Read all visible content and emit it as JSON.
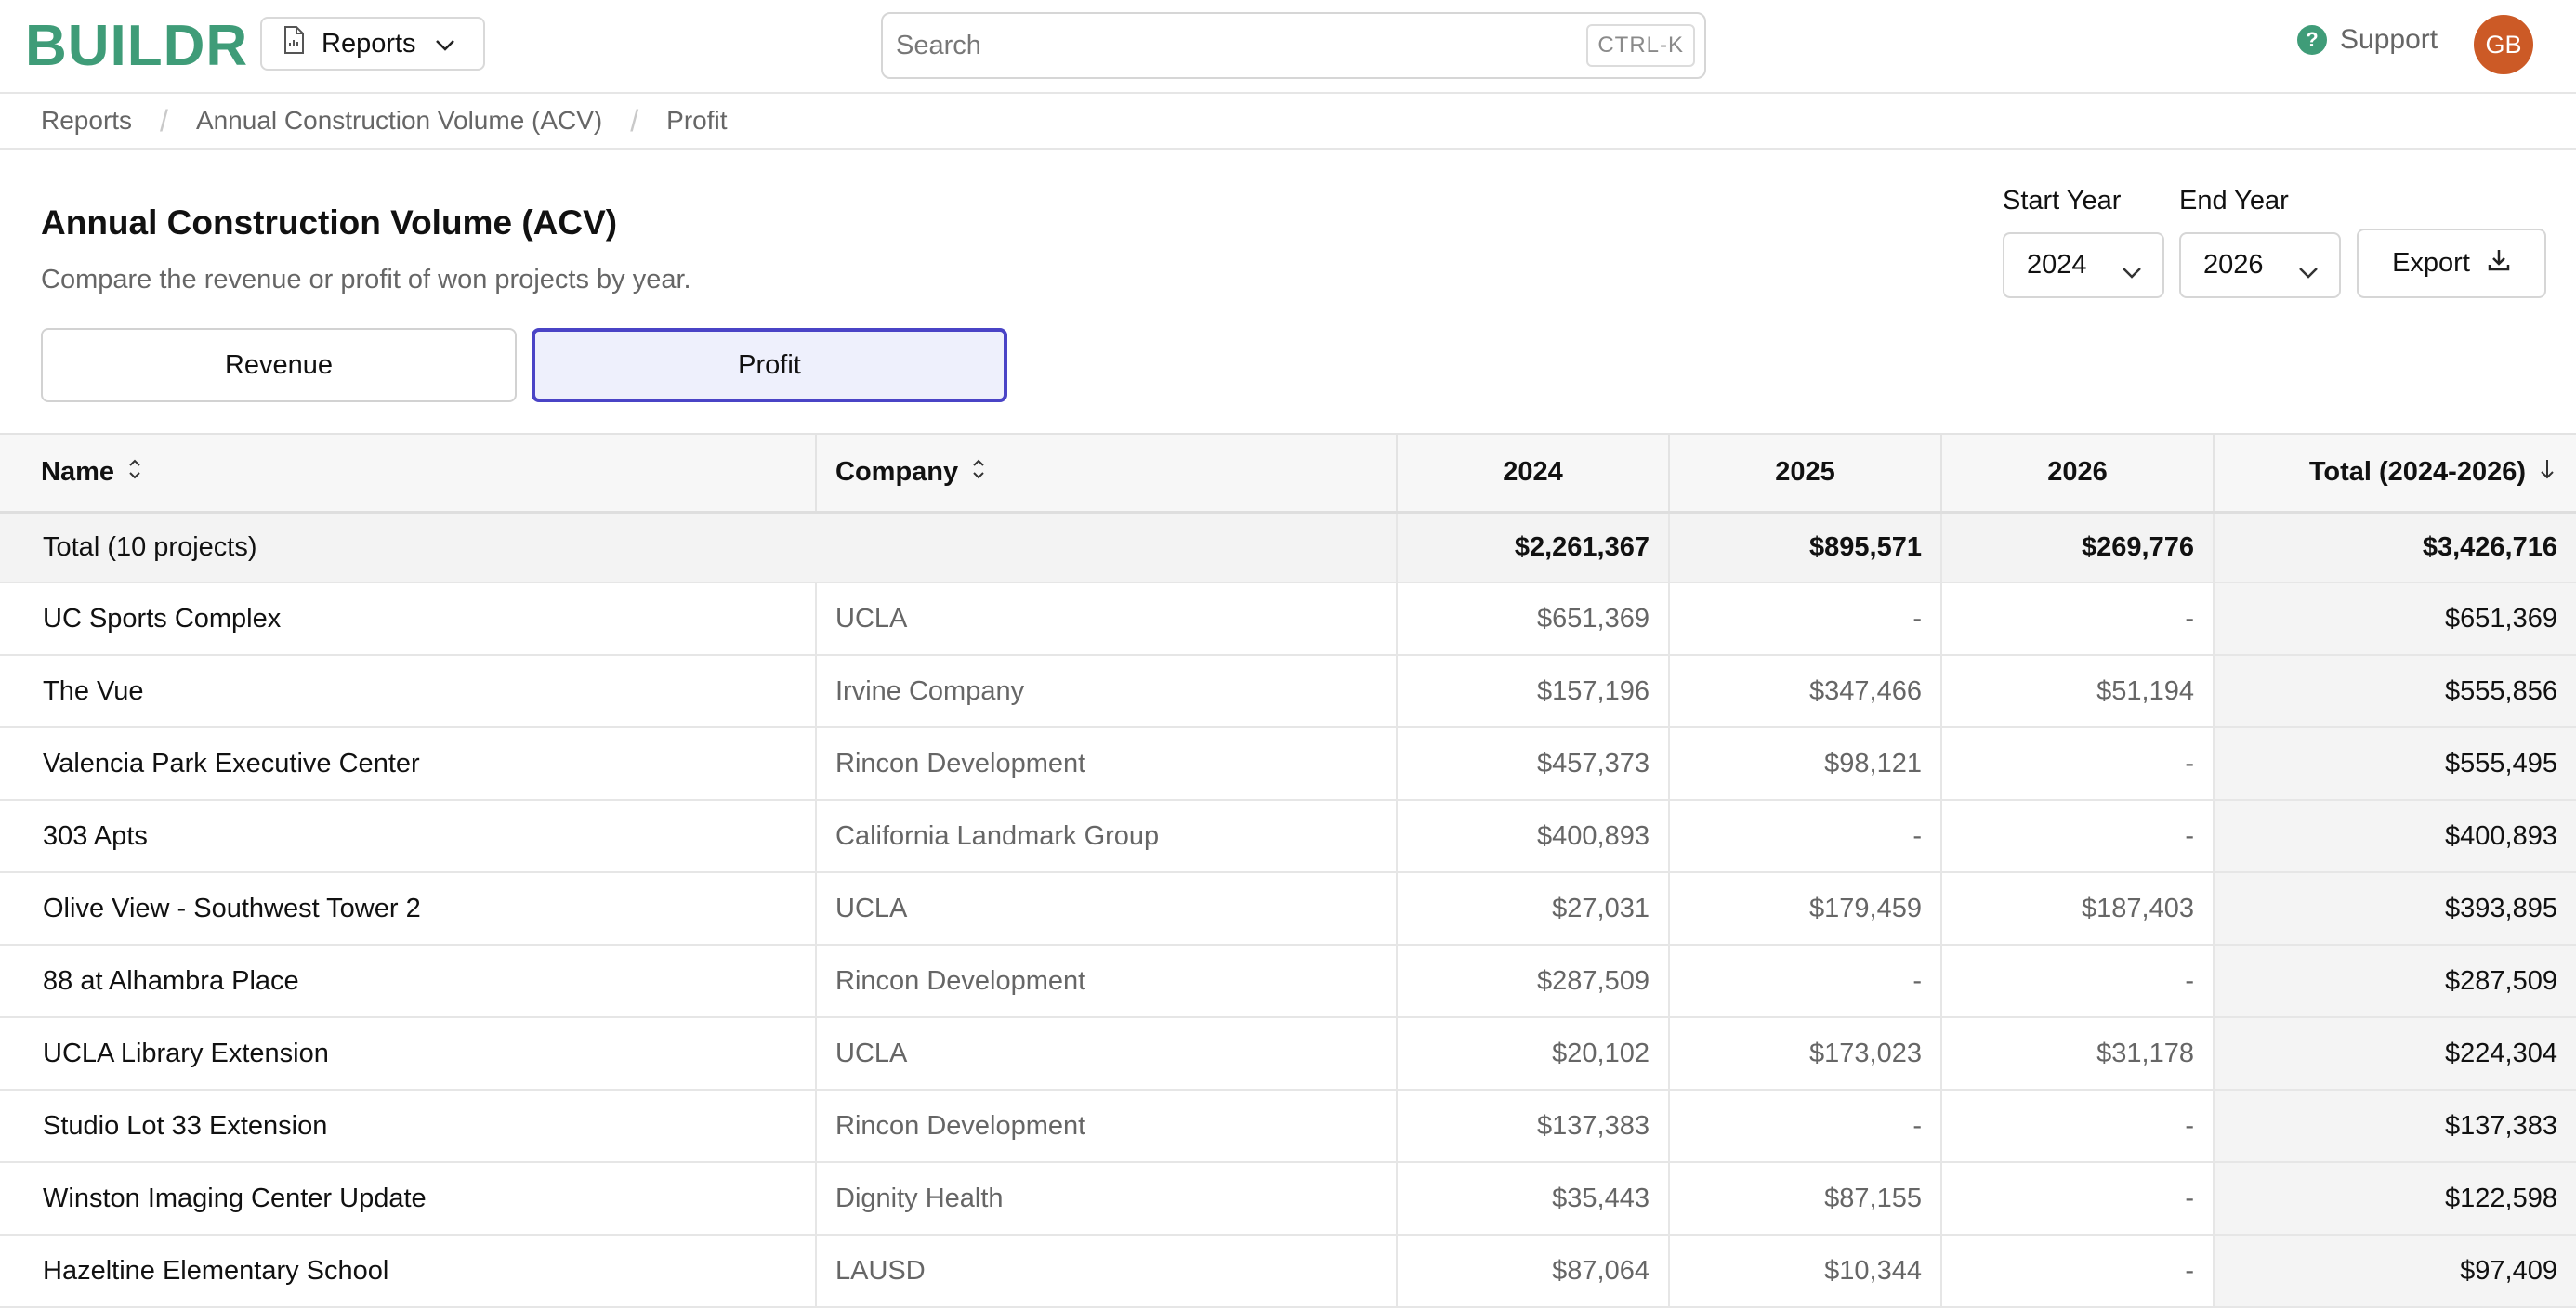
{
  "header": {
    "logo": "BUILDR",
    "reports_menu_label": "Reports",
    "search_placeholder": "Search",
    "search_shortcut": "CTRL-K",
    "support_label": "Support",
    "avatar_initials": "GB",
    "brand_color": "#3f9c78",
    "avatar_color": "#cc5a26"
  },
  "breadcrumb": [
    "Reports",
    "Annual Construction Volume (ACV)",
    "Profit"
  ],
  "page": {
    "title": "Annual Construction Volume (ACV)",
    "subtitle": "Compare the revenue or profit of won projects by year.",
    "toggle": {
      "options": [
        "Revenue",
        "Profit"
      ],
      "selected": "Profit"
    },
    "start_year_label": "Start Year",
    "start_year_value": "2024",
    "end_year_label": "End Year",
    "end_year_value": "2026",
    "export_label": "Export",
    "accent_color": "#4a44c6"
  },
  "table": {
    "columns": [
      "Name",
      "Company",
      "2024",
      "2025",
      "2026",
      "Total (2024-2026)"
    ],
    "sorted_column": "Total (2024-2026)",
    "sort_direction": "descending",
    "total_row": {
      "name": "Total (10 projects)",
      "company": "",
      "y2024": "$2,261,367",
      "y2025": "$895,571",
      "y2026": "$269,776",
      "total": "$3,426,716"
    },
    "rows": [
      {
        "name": "UC Sports Complex",
        "company": "UCLA",
        "y2024": "$651,369",
        "y2025": "-",
        "y2026": "-",
        "total": "$651,369"
      },
      {
        "name": "The Vue",
        "company": "Irvine Company",
        "y2024": "$157,196",
        "y2025": "$347,466",
        "y2026": "$51,194",
        "total": "$555,856"
      },
      {
        "name": "Valencia Park Executive Center",
        "company": "Rincon Development",
        "y2024": "$457,373",
        "y2025": "$98,121",
        "y2026": "-",
        "total": "$555,495"
      },
      {
        "name": "303 Apts",
        "company": "California Landmark Group",
        "y2024": "$400,893",
        "y2025": "-",
        "y2026": "-",
        "total": "$400,893"
      },
      {
        "name": "Olive View - Southwest Tower 2",
        "company": "UCLA",
        "y2024": "$27,031",
        "y2025": "$179,459",
        "y2026": "$187,403",
        "total": "$393,895"
      },
      {
        "name": "88 at Alhambra Place",
        "company": "Rincon Development",
        "y2024": "$287,509",
        "y2025": "-",
        "y2026": "-",
        "total": "$287,509"
      },
      {
        "name": "UCLA Library Extension",
        "company": "UCLA",
        "y2024": "$20,102",
        "y2025": "$173,023",
        "y2026": "$31,178",
        "total": "$224,304"
      },
      {
        "name": "Studio Lot 33 Extension",
        "company": "Rincon Development",
        "y2024": "$137,383",
        "y2025": "-",
        "y2026": "-",
        "total": "$137,383"
      },
      {
        "name": "Winston Imaging Center Update",
        "company": "Dignity Health",
        "y2024": "$35,443",
        "y2025": "$87,155",
        "y2026": "-",
        "total": "$122,598"
      },
      {
        "name": "Hazeltine Elementary School",
        "company": "LAUSD",
        "y2024": "$87,064",
        "y2025": "$10,344",
        "y2026": "-",
        "total": "$97,409"
      }
    ]
  }
}
